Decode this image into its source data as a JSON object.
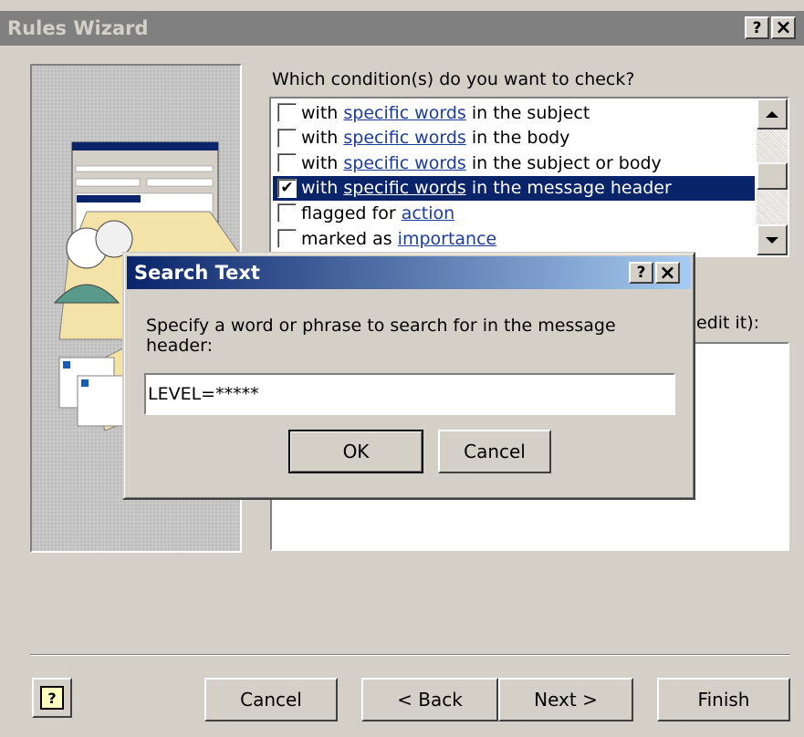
{
  "window": {
    "title": "Rules Wizard",
    "help_btn": "?",
    "close_btn": "×"
  },
  "conditions": {
    "prompt": "Which condition(s) do you want to check?",
    "items": [
      {
        "pre": "with ",
        "link": "specific words",
        "post": " in the subject",
        "checked": false,
        "selected": false
      },
      {
        "pre": "with ",
        "link": "specific words",
        "post": " in the body",
        "checked": false,
        "selected": false
      },
      {
        "pre": "with ",
        "link": "specific words",
        "post": " in the subject or body",
        "checked": false,
        "selected": false
      },
      {
        "pre": "with ",
        "link": "specific words",
        "post": " in the message header",
        "checked": true,
        "selected": true
      },
      {
        "pre": "flagged for ",
        "link": "action",
        "post": "",
        "checked": false,
        "selected": false
      },
      {
        "pre": "marked as ",
        "link": "importance",
        "post": "",
        "checked": false,
        "selected": false
      }
    ]
  },
  "description": {
    "label_partial": "edit it):"
  },
  "dialog": {
    "title": "Search Text",
    "help_btn": "?",
    "close_btn": "×",
    "prompt": "Specify a word or phrase to search for in the message header:",
    "input_value": "LEVEL=*****",
    "ok_label": "OK",
    "cancel_label": "Cancel"
  },
  "footer": {
    "help_icon": "?",
    "cancel_label": "Cancel",
    "back_label": "< Back",
    "next_label": "Next >",
    "finish_label": "Finish"
  }
}
